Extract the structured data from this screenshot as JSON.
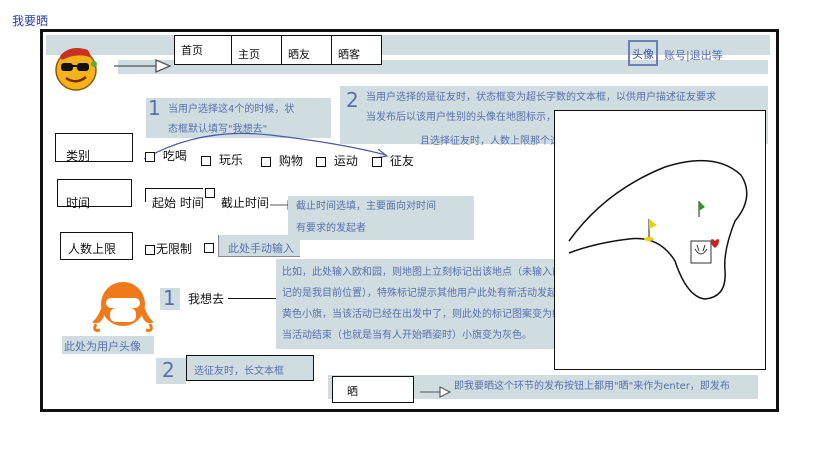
{
  "page_title": "我要晒",
  "header": {
    "tabs": [
      "首页",
      "主页",
      "晒友",
      "晒客"
    ],
    "avatar_label": "头像",
    "account_links": "账号|退出等"
  },
  "filters": {
    "category_label": "类别",
    "categories": [
      "吃喝",
      "玩乐",
      "购物",
      "运动",
      "征友"
    ],
    "time_label": "时间",
    "start_time": "起始 时间",
    "end_time": "截止时间",
    "people_label": "人数上限",
    "unlimited": "无限制",
    "manual_input": "此处手动输入"
  },
  "compose": {
    "want_to_go": "我想去",
    "long_text_hint": "选征友时，长文本框",
    "submit_label": "晒"
  },
  "notes": {
    "note1_marker": "1",
    "note1_line1": "当用户选择这4个的时候，状",
    "note1_line2": "态框默认填写\"我想去\"",
    "note2_marker": "2",
    "note2_line1": "当用户选择的是征友时，状态框变为超长字数的文本框，以供用户描述征友要求",
    "note2_line2": "当发布后以该用户性别的头像在地图标示，比如女孩头像，然后头像多个红心",
    "note2_line3": "且选择征友时，人数上限那个选项变为虚的，即不可选",
    "time_note_line1": "截止时间选填，主要面向对时间",
    "time_note_line2": "有要求的发起者",
    "map_note_marker": "1",
    "map_note_line1": "比如，此处输入欧和园，则地图上立刻标记出该地点（未输入前地图上标",
    "map_note_line2": "记的是我目前位置），特殊标记提示其他用户此处有新活动发起，比如用",
    "map_note_line3": "黄色小旗，当该活动已经在出发中了，则此处的标记图案变为绿色小旗，",
    "map_note_line4": "当活动结束（也就是当有人开始晒姿时）小旗变为灰色。",
    "user_avatar_caption": "此处为用户头像",
    "long_text_marker": "2",
    "submit_note": "即我要晒这个环节的发布按钮上都用\"晒\"来作为enter，即发布"
  },
  "colors": {
    "highlight": "#cfdde0",
    "note_text": "#5a6fb0",
    "title_text": "#2b3f9a",
    "flag_yellow": "#f0d000",
    "flag_green": "#2a9a2a",
    "heart_red": "#cc2222",
    "avatar_orange": "#f07a1a"
  }
}
